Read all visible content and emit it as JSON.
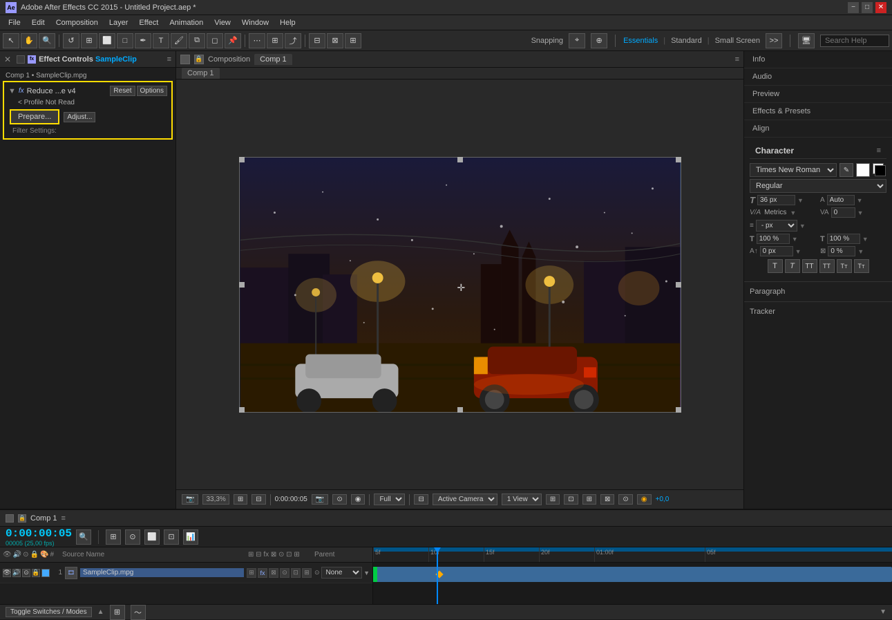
{
  "app": {
    "title": "Adobe After Effects CC 2015 - Untitled Project.aep *",
    "icon": "AE"
  },
  "titlebar": {
    "title": "Adobe After Effects CC 2015 - Untitled Project.aep *",
    "min": "−",
    "max": "□",
    "close": "✕"
  },
  "menubar": {
    "items": [
      "File",
      "Edit",
      "Composition",
      "Layer",
      "Effect",
      "Animation",
      "View",
      "Window",
      "Help"
    ]
  },
  "toolbar": {
    "snapping_label": "Snapping",
    "workspace_essentials": "Essentials",
    "workspace_standard": "Standard",
    "workspace_small": "Small Screen",
    "search_placeholder": "Search Help"
  },
  "effect_controls": {
    "title": "Effect Controls",
    "filename": "SampleClip",
    "layer_info": "Comp 1 • SampleClip.mpg",
    "effect_name": "Reduce ...e v4",
    "profile": "< Profile Not Read",
    "filter_settings": "Filter Settings:",
    "reset_label": "Reset",
    "options_label": "Options",
    "adjust_label": "Adjust...",
    "prepare_label": "Prepare..."
  },
  "composition": {
    "title": "Composition",
    "comp_name": "Comp 1",
    "tab_label": "Comp 1",
    "menu_icon": "≡"
  },
  "viewer_controls": {
    "zoom": "33,3%",
    "time": "0:00:00:05",
    "quality": "Full",
    "view": "Active Camera",
    "views": "1 View",
    "offset": "+0,0"
  },
  "right_panel": {
    "info": "Info",
    "audio": "Audio",
    "preview": "Preview",
    "effects_presets": "Effects & Presets",
    "align": "Align",
    "character": "Character",
    "paragraph": "Paragraph",
    "tracker": "Tracker"
  },
  "character_panel": {
    "title": "Character",
    "font": "Times New Roman",
    "style": "Regular",
    "size": "36 px",
    "auto_label": "Auto",
    "metrics_label": "Metrics",
    "va_value": "0",
    "leading_px": "- px",
    "scale_h": "100 %",
    "scale_v": "100 %",
    "baseline": "0 px",
    "tsumi": "0 %",
    "text_styles": [
      "T",
      "T",
      "TT",
      "TT",
      "T",
      "T"
    ]
  },
  "timeline": {
    "comp_name": "Comp 1",
    "timecode": "0:00:00:05",
    "timecode_sub": "00005 (25,00 fps)",
    "toggle_label": "Toggle Switches / Modes",
    "layer": {
      "number": "1",
      "name": "SampleClip.mpg",
      "parent": "None"
    }
  },
  "time_markers": [
    "5f",
    "10f",
    "15f",
    "20f",
    "01:00f",
    "05f"
  ]
}
